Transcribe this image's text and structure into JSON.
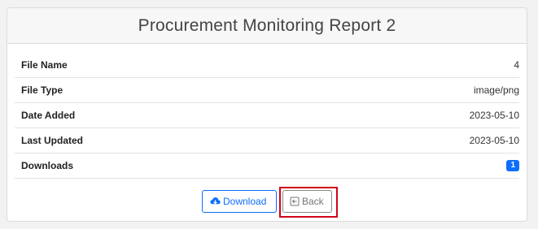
{
  "card": {
    "title": "Procurement Monitoring Report 2"
  },
  "details": [
    {
      "label": "File Name",
      "value": "4"
    },
    {
      "label": "File Type",
      "value": "image/png"
    },
    {
      "label": "Date Added",
      "value": "2023-05-10"
    },
    {
      "label": "Last Updated",
      "value": "2023-05-10"
    },
    {
      "label": "Downloads",
      "value": "1"
    }
  ],
  "actions": {
    "download_label": "Download",
    "back_label": "Back"
  },
  "icons": {
    "download": "cloud-download-icon",
    "back": "box-arrow-left-icon"
  },
  "colors": {
    "primary": "#0d6efd",
    "highlight": "#d0021b"
  }
}
